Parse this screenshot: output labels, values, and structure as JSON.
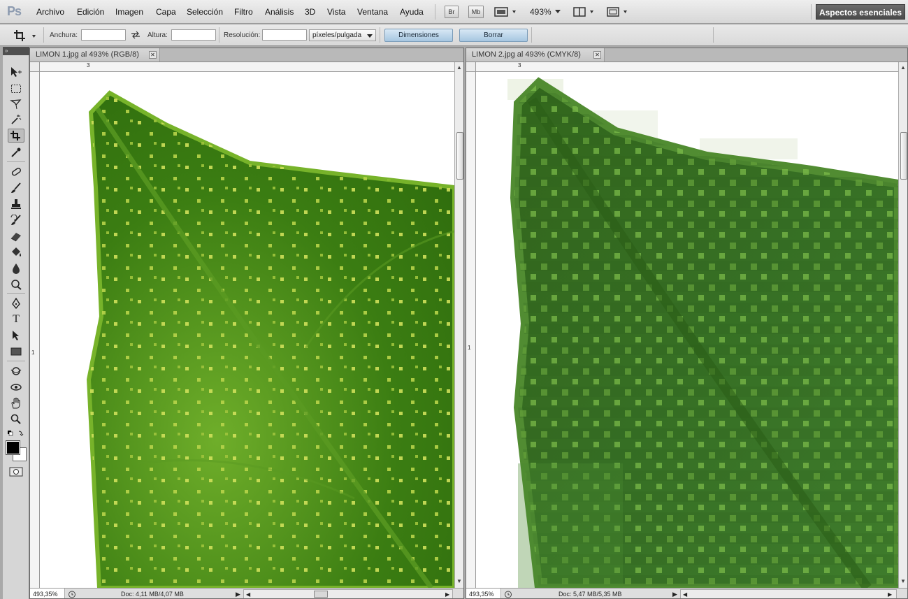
{
  "app": {
    "logo": "Ps"
  },
  "menu": [
    "Archivo",
    "Edición",
    "Imagen",
    "Capa",
    "Selección",
    "Filtro",
    "Análisis",
    "3D",
    "Vista",
    "Ventana",
    "Ayuda"
  ],
  "menubar_buttons": {
    "bridge": "Br",
    "mini_bridge": "Mb",
    "zoom_level": "493%"
  },
  "workspace": "Aspectos esenciales",
  "options": {
    "width_label": "Anchura:",
    "height_label": "Altura:",
    "resolution_label": "Resolución:",
    "width_value": "",
    "height_value": "",
    "resolution_value": "",
    "units": "píxeles/pulgada",
    "dimensions_button": "Dimensiones",
    "clear_button": "Borrar"
  },
  "documents": [
    {
      "tab_title": "LIMON 1.jpg al 493% (RGB/8)",
      "ruler_h_label": "3",
      "ruler_v_label": "1",
      "zoom": "493,35%",
      "doc_size": "Doc: 4,11 MB/4,07 MB",
      "leaf_color": "#3e7d14",
      "dot_color": "#cfe05a"
    },
    {
      "tab_title": "LIMON 2.jpg al 493% (CMYK/8)",
      "ruler_h_label": "3",
      "ruler_v_label": "1",
      "zoom": "493,35%",
      "doc_size": "Doc: 5,47 MB/5,35 MB",
      "leaf_color": "#356e24",
      "dot_color": "#7dbe4a"
    }
  ],
  "colors": {
    "foreground": "#000000",
    "background": "#ffffff"
  }
}
